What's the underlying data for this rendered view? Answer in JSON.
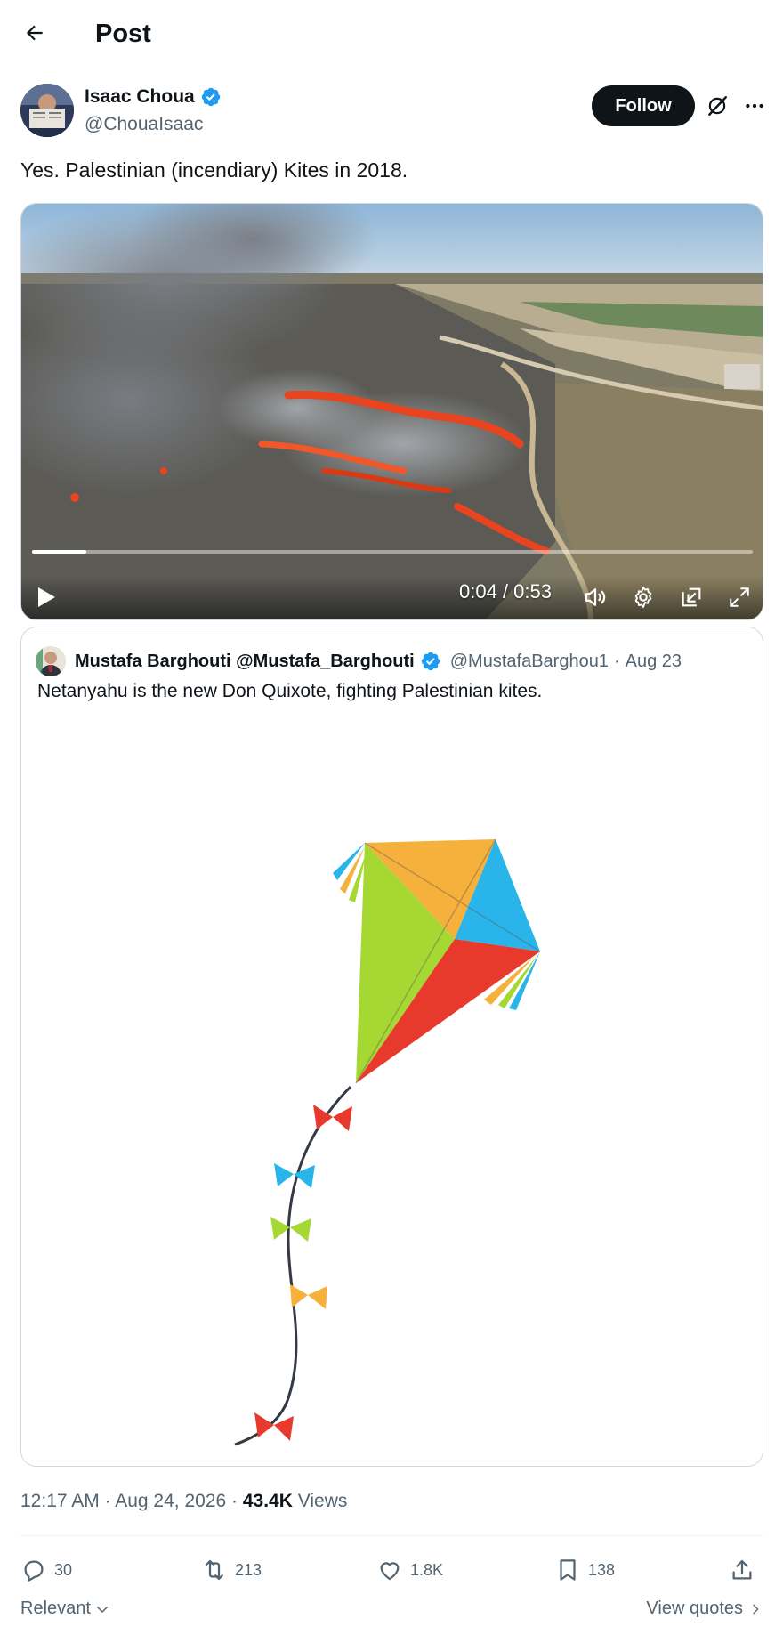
{
  "header": {
    "title": "Post",
    "back_icon": "arrow-left-icon"
  },
  "post": {
    "author_name": "Isaac Choua",
    "author_handle": "@ChouaIsaac",
    "verified": true,
    "follow_label": "Follow",
    "text": "Yes. Palestinian (incendiary) Kites in 2018.",
    "video": {
      "current_time": "0:04",
      "duration": "0:53",
      "time_display": "0:04 / 0:53",
      "progress": 0.075
    },
    "quote": {
      "name": "Mustafa Barghouti @Mustafa_Barghouti",
      "handle": "@MustafaBarghou1",
      "separator": "·",
      "date": "Aug 23",
      "text": "Netanyahu is the new Don Quixote, fighting Palestinian kites."
    },
    "timestamp": "12:17 AM · Aug 24, 2026 · ",
    "views_count": "43.4K",
    "views_label": " Views",
    "stats": {
      "replies": "30",
      "reposts": "213",
      "likes": "1.8K",
      "bookmarks": "138"
    },
    "sort_label": "Relevant",
    "view_quotes_label": "View quotes"
  },
  "colors": {
    "text_primary": "#0f1419",
    "text_secondary": "#536471",
    "verified_blue": "#1d9bf0",
    "border": "#cfd9de"
  }
}
